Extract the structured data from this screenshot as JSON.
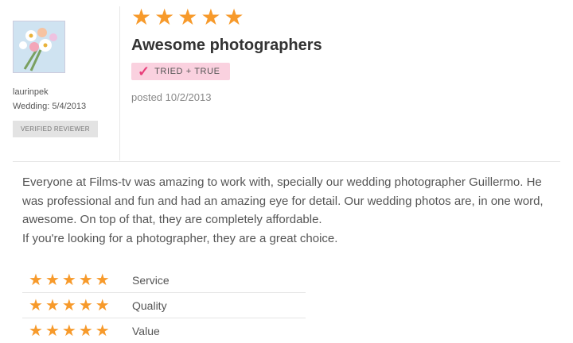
{
  "review": {
    "star_rating": 5,
    "title": "Awesome photographers",
    "badge_label": "TRIED + TRUE",
    "posted": "posted 10/2/2013",
    "body": [
      "Everyone at Films-tv was amazing to work with, specially our wedding photographer Guillermo. He was professional and fun and had an amazing eye for detail. Our wedding photos are, in one word, awesome. On top of that, they are completely affordable.",
      "If you're looking for a photographer, they are a great choice."
    ]
  },
  "reviewer": {
    "name": "laurinpek",
    "wedding_date": "Wedding: 5/4/2013",
    "verified_label": "VERIFIED REVIEWER"
  },
  "ratings": [
    {
      "label": "Service",
      "stars": 5
    },
    {
      "label": "Quality",
      "stars": 5
    },
    {
      "label": "Value",
      "stars": 5
    }
  ],
  "colors": {
    "star": "#f79a2b",
    "badge_bg": "#fad1df",
    "check": "#e83e7a"
  }
}
